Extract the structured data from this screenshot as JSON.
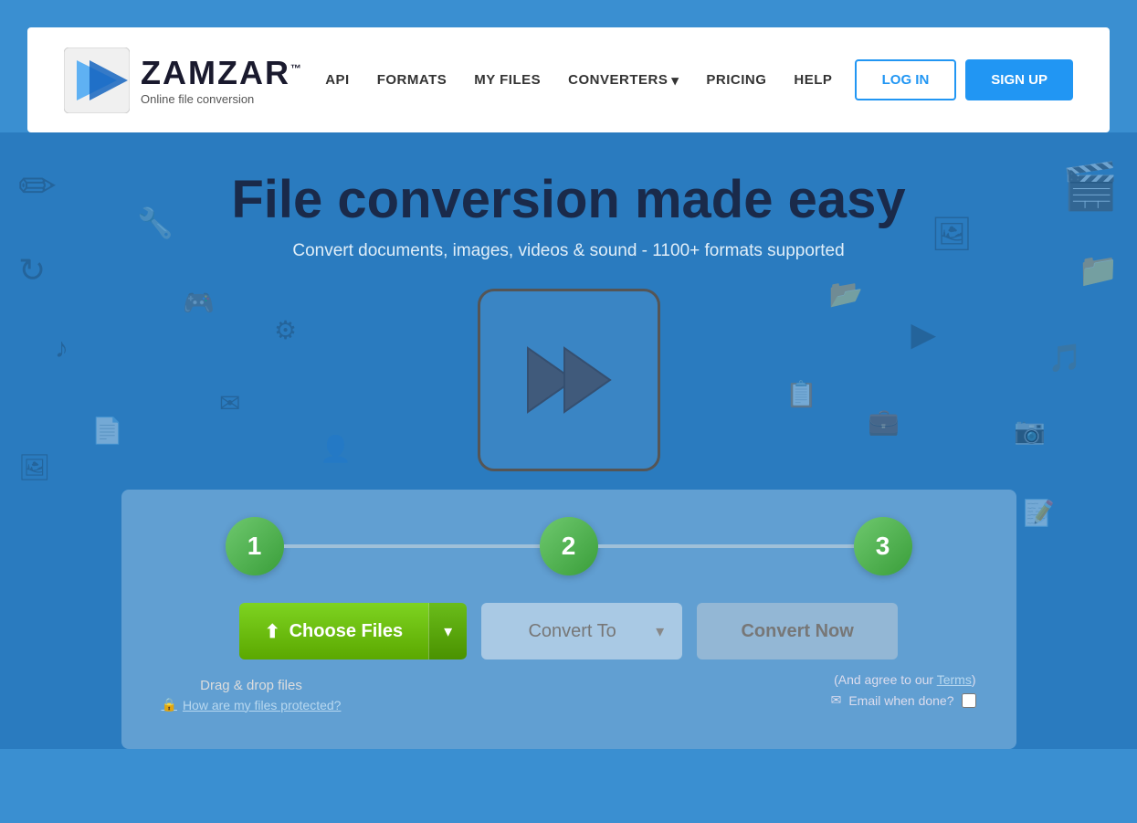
{
  "header": {
    "logo_name": "ZAMZAR",
    "logo_tm": "™",
    "logo_sub": "Online file conversion",
    "nav": {
      "items": [
        {
          "id": "api",
          "label": "API"
        },
        {
          "id": "formats",
          "label": "FORMATS"
        },
        {
          "id": "my-files",
          "label": "MY FILES"
        },
        {
          "id": "converters",
          "label": "CONVERTERS",
          "has_dropdown": true
        },
        {
          "id": "pricing",
          "label": "PRICING"
        },
        {
          "id": "help",
          "label": "HELP"
        }
      ]
    },
    "login_label": "LOG IN",
    "signup_label": "SIGN UP"
  },
  "hero": {
    "title_part1": "File conversion made ",
    "title_part2": "easy",
    "subtitle": "Convert documents, images, videos & sound - 1100+ formats supported"
  },
  "panel": {
    "step1": "1",
    "step2": "2",
    "step3": "3",
    "choose_files_label": "Choose Files",
    "dropdown_arrow": "▾",
    "convert_to_label": "Convert To",
    "convert_now_label": "Convert Now",
    "drag_drop_text": "Drag & drop files",
    "protection_icon": "🔒",
    "protection_label": "How are my files protected?",
    "agree_text": "(And agree to our ",
    "terms_label": "Terms",
    "agree_text2": ")",
    "email_label": "Email when done?",
    "upload_icon": "⬆"
  }
}
